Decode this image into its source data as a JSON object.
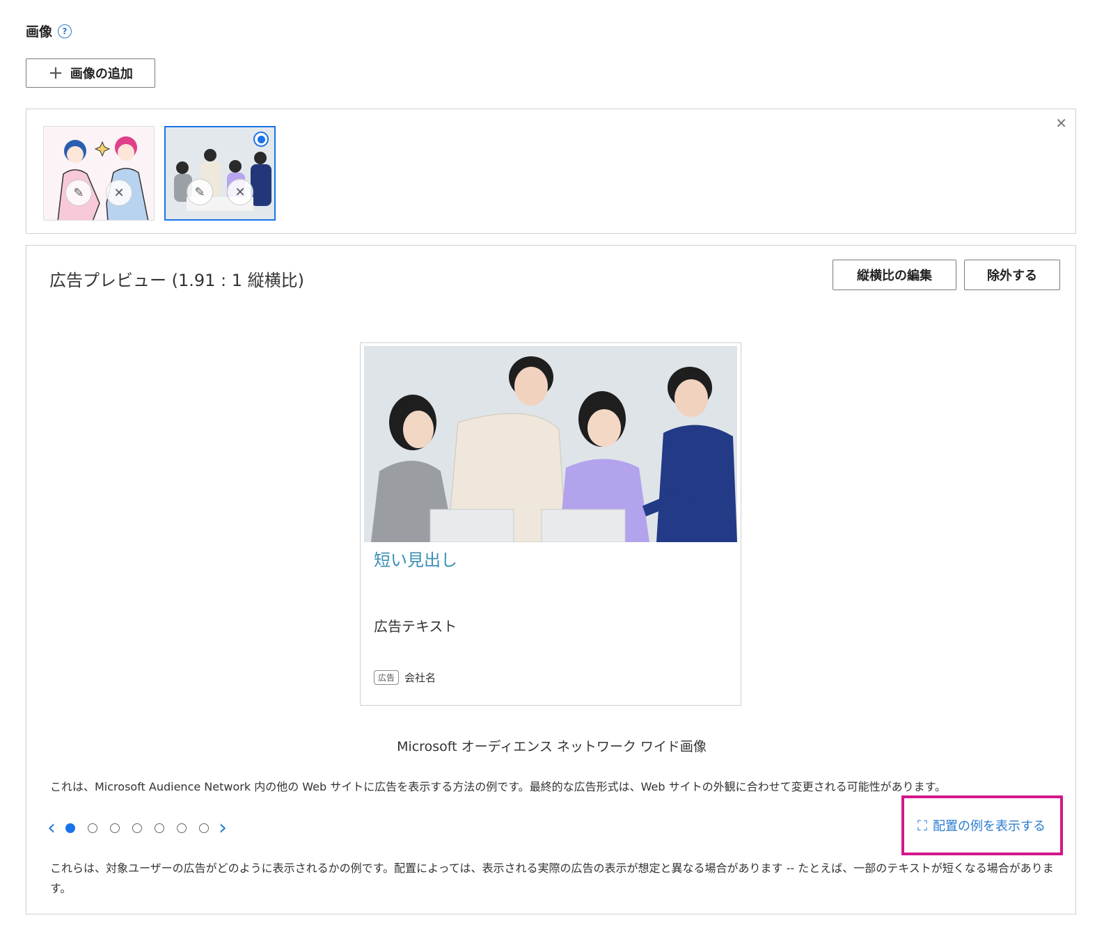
{
  "images_section": {
    "title": "画像",
    "help_icon": "question-circle-icon",
    "add_button_label": "画像の追加"
  },
  "preview": {
    "title": "広告プレビュー (1.91 : 1 縦横比)",
    "edit_aspect_label": "縦横比の編集",
    "exclude_label": "除外する",
    "ad": {
      "headline": "短い見出し",
      "text": "広告テキスト",
      "badge": "広告",
      "company": "会社名"
    },
    "caption": "Microsoft オーディエンス ネットワーク ワイド画像",
    "description": "これは、Microsoft Audience Network 内の他の Web サイトに広告を表示する方法の例です。最終的な広告形式は、Web サイトの外観に合わせて変更される可能性があります。",
    "pager": {
      "total": 7,
      "active_index": 0
    },
    "show_examples_label": "配置の例を表示する",
    "footer_note": "これらは、対象ユーザーの広告がどのように表示されるかの例です。配置によっては、表示される実際の広告の表示が想定と異なる場合があります -- たとえば、一部のテキストが短くなる場合があります。"
  },
  "colors": {
    "accent": "#1a73e8",
    "link": "#2b7bd1",
    "headline": "#3a8fb7",
    "highlight": "#d4168b"
  }
}
